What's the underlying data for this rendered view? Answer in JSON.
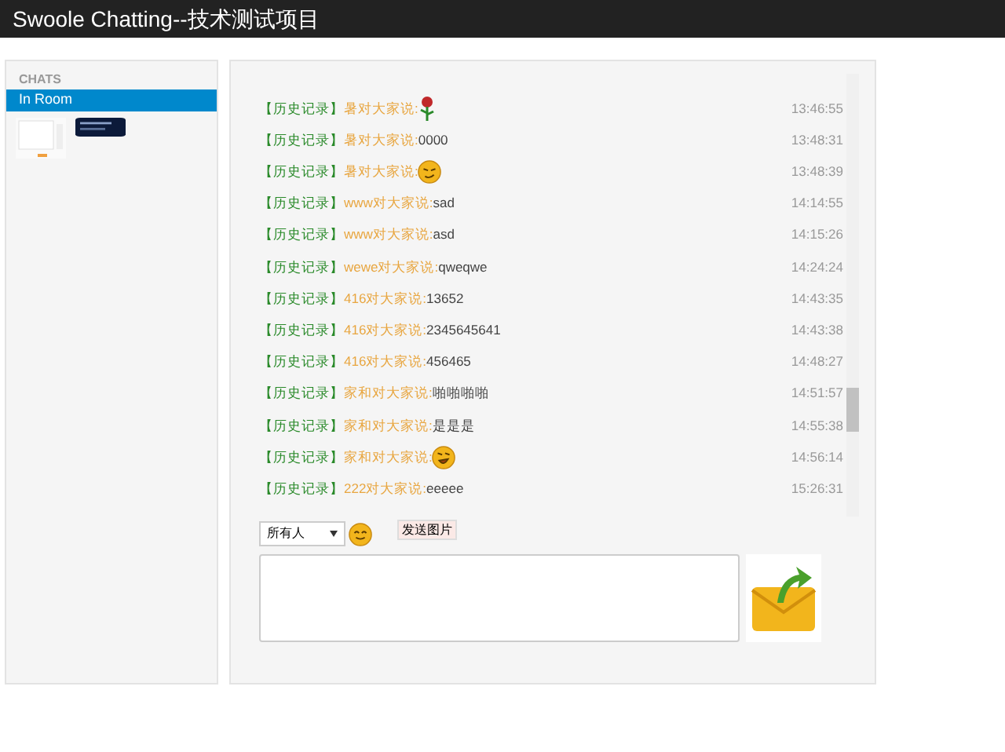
{
  "header": {
    "title": "Swoole Chatting--技术测试项目"
  },
  "sidebar": {
    "heading": "CHATS",
    "items": [
      {
        "label": "In Room",
        "selected": true
      }
    ]
  },
  "messages": [
    {
      "tag": "【历史记录】",
      "user": "暑对大家说:",
      "kind": "rose",
      "time": "13:46:55"
    },
    {
      "tag": "【历史记录】",
      "user": "暑对大家说:",
      "kind": "text",
      "text": "0000",
      "time": "13:48:31"
    },
    {
      "tag": "【历史记录】",
      "user": "暑对大家说:",
      "kind": "wink",
      "time": "13:48:39"
    },
    {
      "tag": "【历史记录】",
      "user": "www对大家说:",
      "kind": "text",
      "text": "sad",
      "time": "14:14:55"
    },
    {
      "tag": "【历史记录】",
      "user": "www对大家说:",
      "kind": "text",
      "text": "asd",
      "time": "14:15:26"
    },
    {
      "tag": "【历史记录】",
      "user": "wewe对大家说:",
      "kind": "text",
      "text": "qweqwe",
      "time": "14:24:24"
    },
    {
      "tag": "【历史记录】",
      "user": "416对大家说:",
      "kind": "text",
      "text": "13652",
      "time": "14:43:35"
    },
    {
      "tag": "【历史记录】",
      "user": "416对大家说:",
      "kind": "text",
      "text": "2345645641",
      "time": "14:43:38"
    },
    {
      "tag": "【历史记录】",
      "user": "416对大家说:",
      "kind": "text",
      "text": "456465",
      "time": "14:48:27"
    },
    {
      "tag": "【历史记录】",
      "user": "家和对大家说:",
      "kind": "text",
      "text": "啪啪啪啪",
      "time": "14:51:57"
    },
    {
      "tag": "【历史记录】",
      "user": "家和对大家说:",
      "kind": "text",
      "text": "是是是",
      "time": "14:55:38"
    },
    {
      "tag": "【历史记录】",
      "user": "家和对大家说:",
      "kind": "laugh",
      "time": "14:56:14"
    },
    {
      "tag": "【历史记录】",
      "user": "222对大家说:",
      "kind": "text",
      "text": "eeeee",
      "time": "15:26:31"
    }
  ],
  "composer": {
    "recipient": "所有人",
    "send_image_button": "发送图片"
  }
}
